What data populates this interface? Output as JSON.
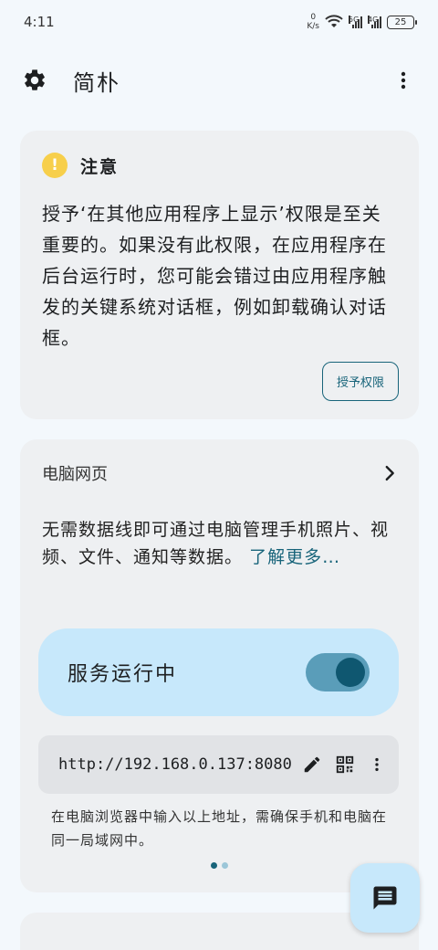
{
  "status_bar": {
    "time": "4:11",
    "net_speed_value": "0",
    "net_speed_unit": "K/s",
    "sim1": "5G",
    "sim2": "4G",
    "battery": "25"
  },
  "app_bar": {
    "title": "简朴",
    "settings_icon": "gear-icon",
    "menu_icon": "more-vert-icon"
  },
  "warning_card": {
    "title": "注意",
    "icon_symbol": "!",
    "body": "授予‘在其他应用程序上显示’权限是至关重要的。如果没有此权限，在应用程序在后台运行时，您可能会错过由应用程序触发的关键系统对话框，例如卸载确认对话框。",
    "grant_button": "授予权限"
  },
  "web_card": {
    "title": "电脑网页",
    "description": "无需数据线即可通过电脑管理手机照片、视频、文件、通知等数据。",
    "learn_more": "了解更多…",
    "service_label": "服务运行中",
    "service_running": true,
    "url": "http://192.168.0.137:8080",
    "hint": "在电脑浏览器中输入以上地址，需确保手机和电脑在同一局域网中。",
    "page_count": 2,
    "active_page": 1
  },
  "fab": {
    "icon": "chat-icon"
  },
  "colors": {
    "accent": "#18647a",
    "panel_blue": "#c7e8fb",
    "card_bg": "#eef0f2",
    "warning_yellow": "#f7cf4b"
  }
}
